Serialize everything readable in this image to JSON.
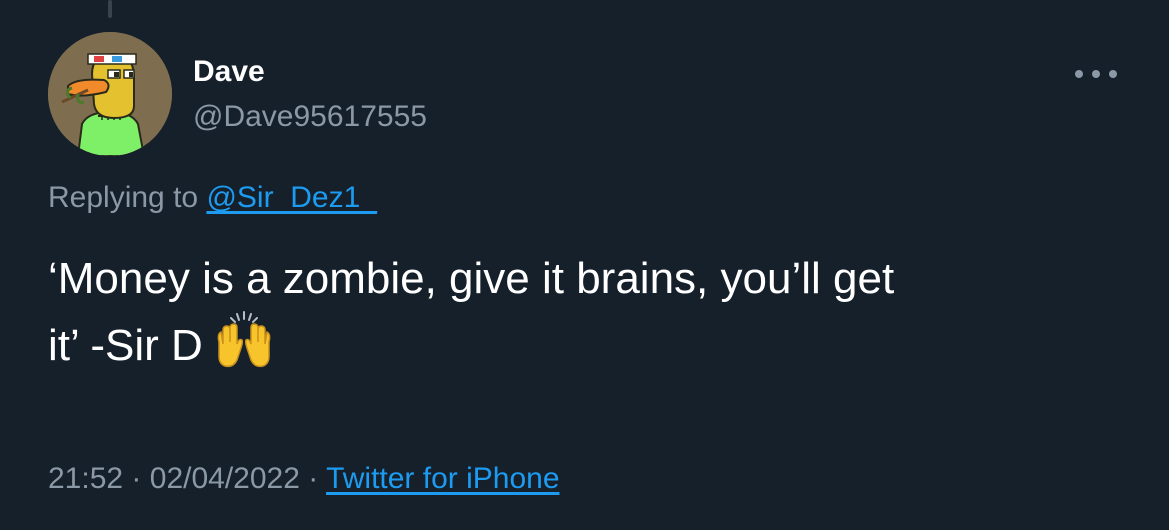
{
  "tweet": {
    "author": {
      "display_name": "Dave",
      "handle": "@Dave95617555",
      "avatar_icon": "duck-avatar-icon"
    },
    "more_icon": "more-options-icon",
    "replying_label": "Replying to",
    "replying_to": "@Sir_Dez1_",
    "text_line1": "‘Money is a zombie, give it brains, you’ll get",
    "text_line2": "it’ -Sir D",
    "emoji_icon": "raising-hands-emoji",
    "time": "21:52",
    "separator": "·",
    "date": "02/04/2022",
    "source": "Twitter for iPhone"
  },
  "colors": {
    "background": "#15202b",
    "primary_text": "#ffffff",
    "secondary_text": "#8b98a5",
    "link": "#1d9bf0"
  }
}
